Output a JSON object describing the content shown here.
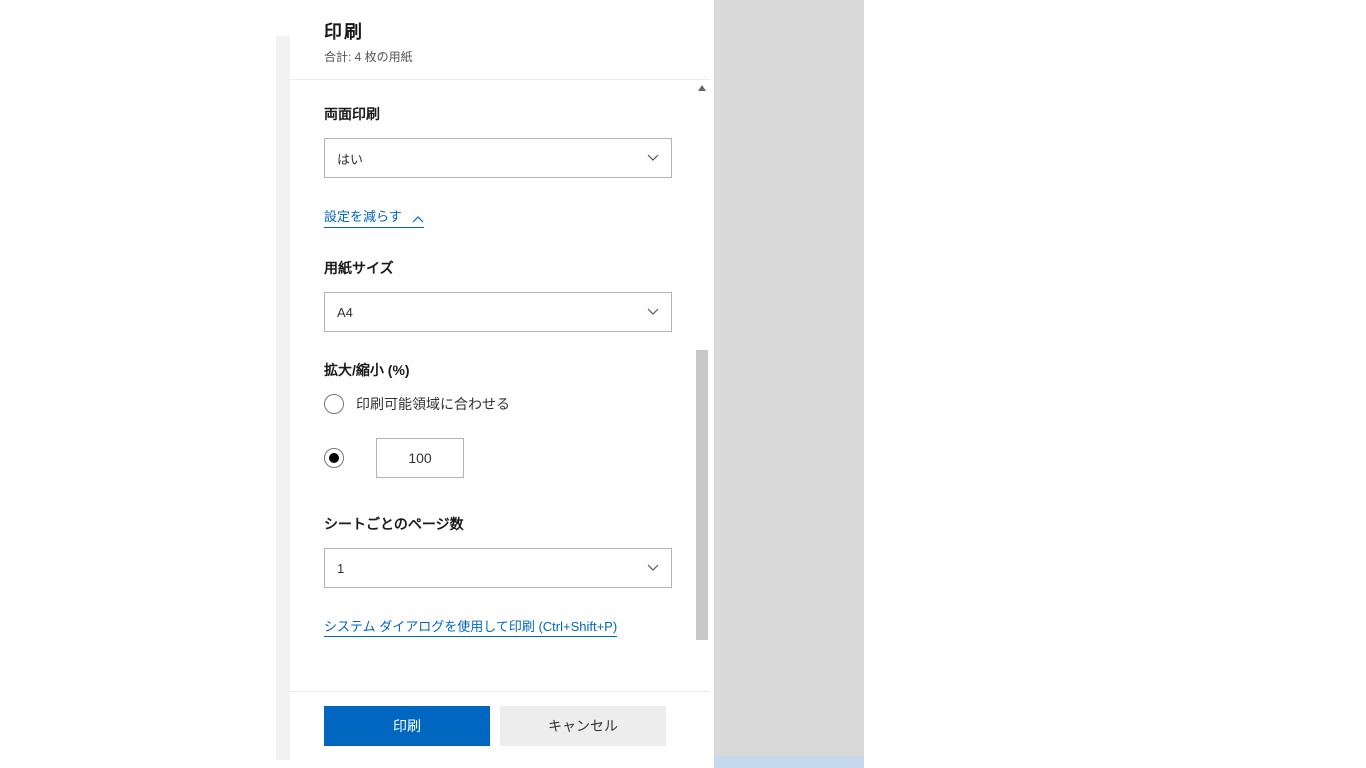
{
  "header": {
    "title": "印刷",
    "subtitle": "合計: 4 枚の用紙"
  },
  "sections": {
    "duplex": {
      "label": "両面印刷",
      "value": "はい"
    },
    "collapse_link": {
      "label": "設定を減らす"
    },
    "paper_size": {
      "label": "用紙サイズ",
      "value": "A4"
    },
    "scale": {
      "label": "拡大/縮小 (%)",
      "fit_option": "印刷可能領域に合わせる",
      "custom_value": "100"
    },
    "pages_per_sheet": {
      "label": "シートごとのページ数",
      "value": "1"
    },
    "system_dialog_link": "システム ダイアログを使用して印刷 (Ctrl+Shift+P)"
  },
  "footer": {
    "print": "印刷",
    "cancel": "キャンセル"
  }
}
